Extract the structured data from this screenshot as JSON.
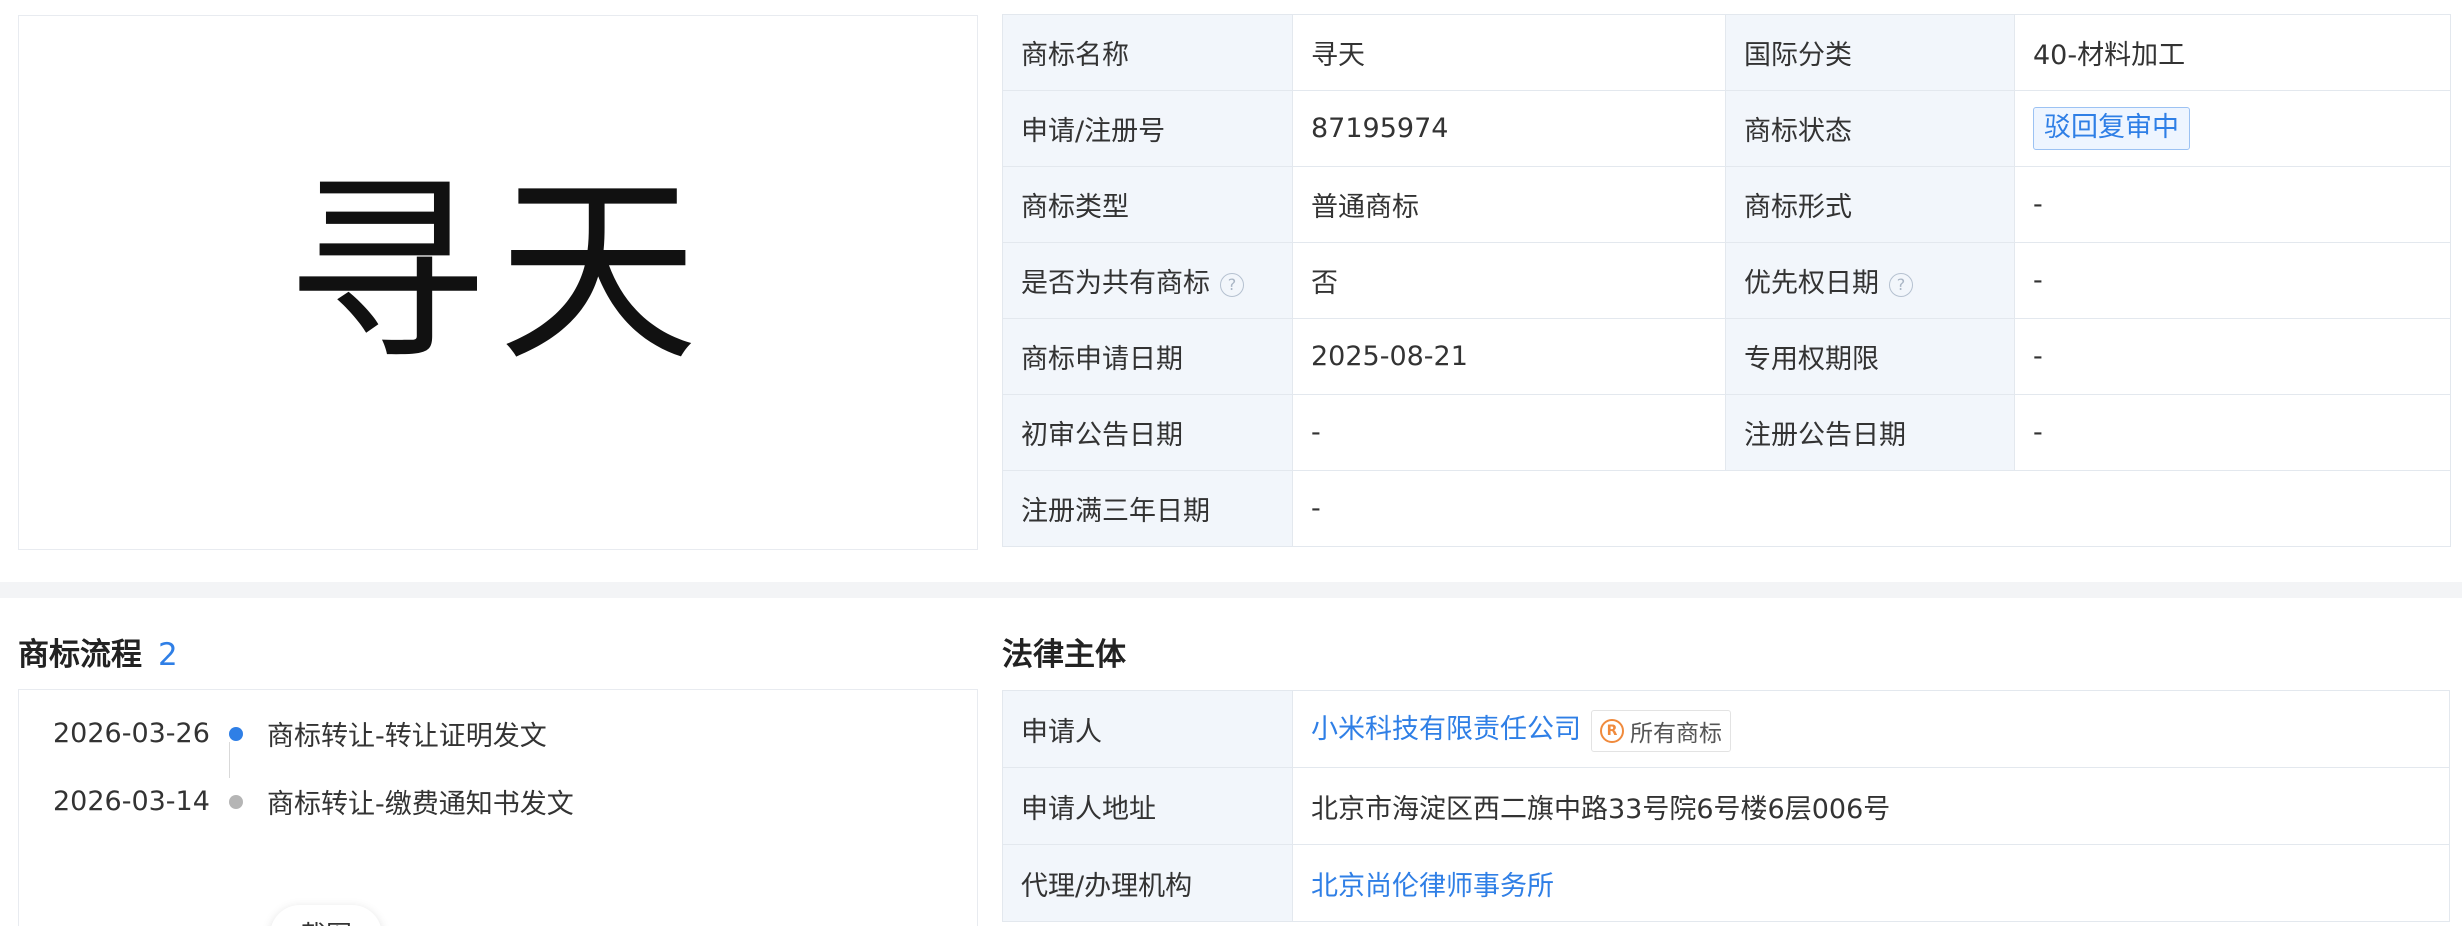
{
  "trademark_image": {
    "text": "寻天"
  },
  "info": {
    "rows": [
      {
        "l1": "商标名称",
        "v1": "寻天",
        "l2": "国际分类",
        "v2": "40-材料加工"
      },
      {
        "l1": "申请/注册号",
        "v1": "87195974",
        "l2": "商标状态",
        "v2": "驳回复审中"
      },
      {
        "l1": "商标类型",
        "v1": "普通商标",
        "l2": "商标形式",
        "v2": "-"
      },
      {
        "l1": "是否为共有商标",
        "v1": "否",
        "l2": "优先权日期",
        "v2": "-"
      },
      {
        "l1": "商标申请日期",
        "v1": "2025-08-21",
        "l2": "专用权期限",
        "v2": "-"
      },
      {
        "l1": "初审公告日期",
        "v1": "-",
        "l2": "注册公告日期",
        "v2": "-"
      },
      {
        "l1": "注册满三年日期",
        "v1": "-"
      }
    ],
    "help_glyph": "?"
  },
  "process": {
    "title": "商标流程",
    "count": "2",
    "items": [
      {
        "date": "2026-03-26",
        "event": "商标转让-转让证明发文"
      },
      {
        "date": "2026-03-14",
        "event": "商标转让-缴费通知书发文"
      }
    ],
    "floating_button": "截图"
  },
  "legal": {
    "title": "法律主体",
    "rows": [
      {
        "label": "申请人",
        "value": "小米科技有限责任公司",
        "tag": "所有商标",
        "tag_icon": "R"
      },
      {
        "label": "申请人地址",
        "value": "北京市海淀区西二旗中路33号院6号楼6层006号"
      },
      {
        "label": "代理/办理机构",
        "value": "北京尚伦律师事务所"
      }
    ]
  },
  "colors": {
    "link": "#2f7fe6",
    "label_bg": "#f2f6fb",
    "border": "#e3e8ee",
    "registered_icon": "#f08a3c"
  }
}
